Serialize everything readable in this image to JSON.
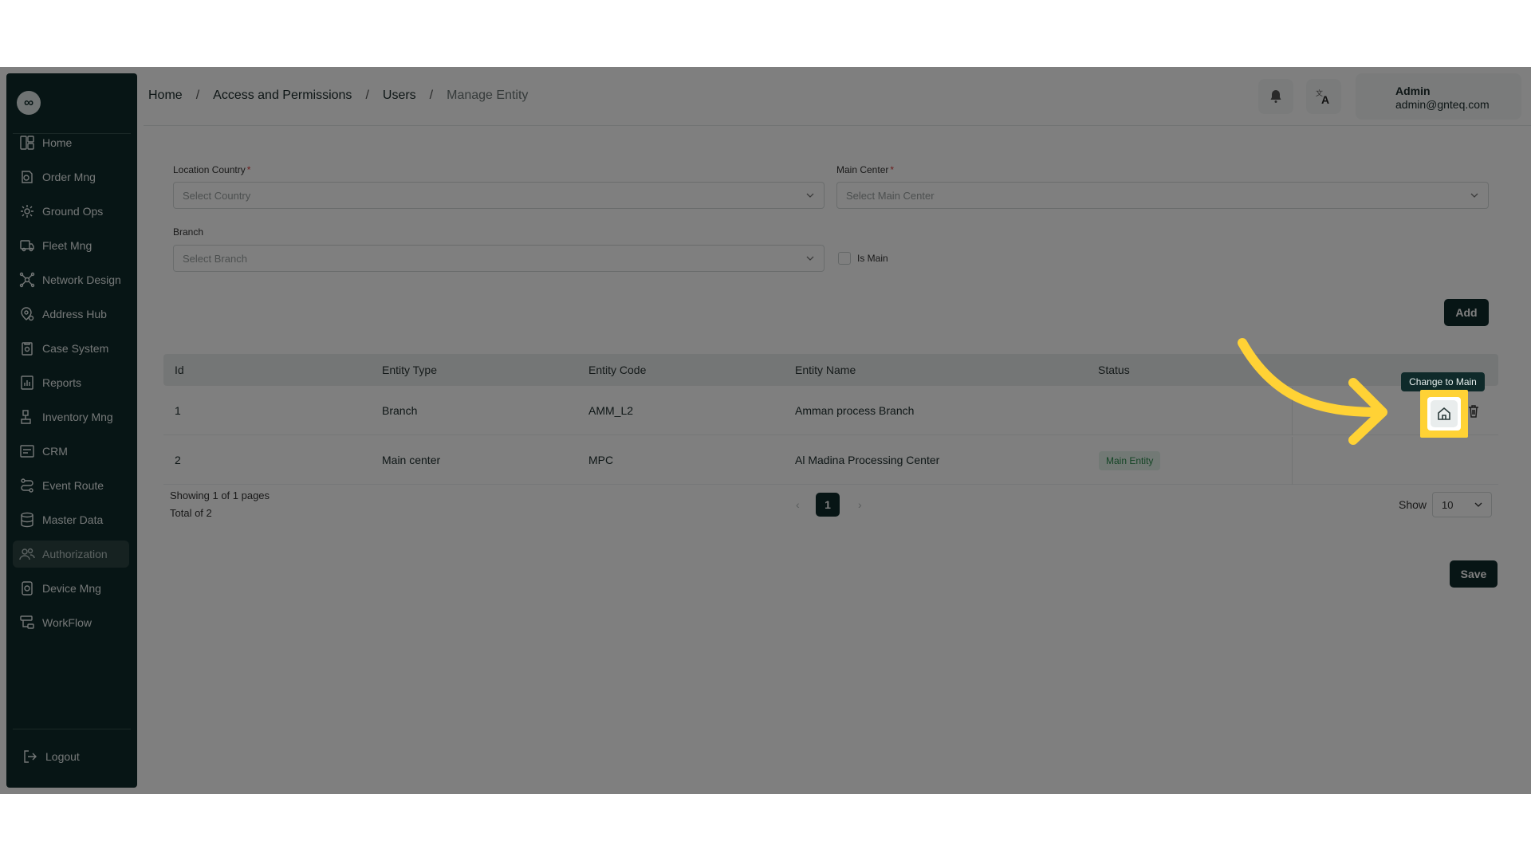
{
  "sidebar": {
    "items": [
      {
        "label": "Home",
        "icon": "dashboard-icon"
      },
      {
        "label": "Order Mng",
        "icon": "order-icon"
      },
      {
        "label": "Ground Ops",
        "icon": "ground-ops-icon"
      },
      {
        "label": "Fleet Mng",
        "icon": "truck-icon"
      },
      {
        "label": "Network Design",
        "icon": "network-icon"
      },
      {
        "label": "Address Hub",
        "icon": "location-icon"
      },
      {
        "label": "Case System",
        "icon": "case-icon"
      },
      {
        "label": "Reports",
        "icon": "reports-icon"
      },
      {
        "label": "Inventory Mng",
        "icon": "inventory-icon"
      },
      {
        "label": "CRM",
        "icon": "crm-icon"
      },
      {
        "label": "Event Route",
        "icon": "route-icon"
      },
      {
        "label": "Master Data",
        "icon": "database-icon"
      },
      {
        "label": "Authorization",
        "icon": "users-icon",
        "active": true
      },
      {
        "label": "Device Mng",
        "icon": "device-icon"
      },
      {
        "label": "WorkFlow",
        "icon": "workflow-icon"
      }
    ],
    "logout": "Logout"
  },
  "breadcrumb": {
    "home": "Home",
    "access": "Access and Permissions",
    "users": "Users",
    "current": "Manage Entity",
    "separator": "/"
  },
  "user": {
    "name": "Admin",
    "email": "admin@gnteq.com"
  },
  "form": {
    "country_label": "Location Country",
    "country_placeholder": "Select Country",
    "main_center_label": "Main Center",
    "main_center_placeholder": "Select Main Center",
    "branch_label": "Branch",
    "branch_placeholder": "Select Branch",
    "is_main_label": "Is Main",
    "required_mark": "*",
    "add_button": "Add"
  },
  "table": {
    "headers": [
      "Id",
      "Entity Type",
      "Entity Code",
      "Entity Name",
      "Status"
    ],
    "rows": [
      {
        "id": "1",
        "type": "Branch",
        "code": "AMM_L2",
        "name": "Amman process Branch",
        "status": ""
      },
      {
        "id": "2",
        "type": "Main center",
        "code": "MPC",
        "name": "Al Madina Processing Center",
        "status": "Main Entity"
      }
    ]
  },
  "pagination": {
    "showing": "Showing 1 of 1 pages",
    "total": "Total of 2",
    "prev": "‹",
    "page": "1",
    "next": "›",
    "show_label": "Show",
    "page_size": "10"
  },
  "save_button": "Save",
  "tooltip": "Change to Main",
  "colors": {
    "sidebar_bg": "#0f2a2a",
    "highlight": "#ffd235",
    "badge_green": "#2b8a4d"
  }
}
